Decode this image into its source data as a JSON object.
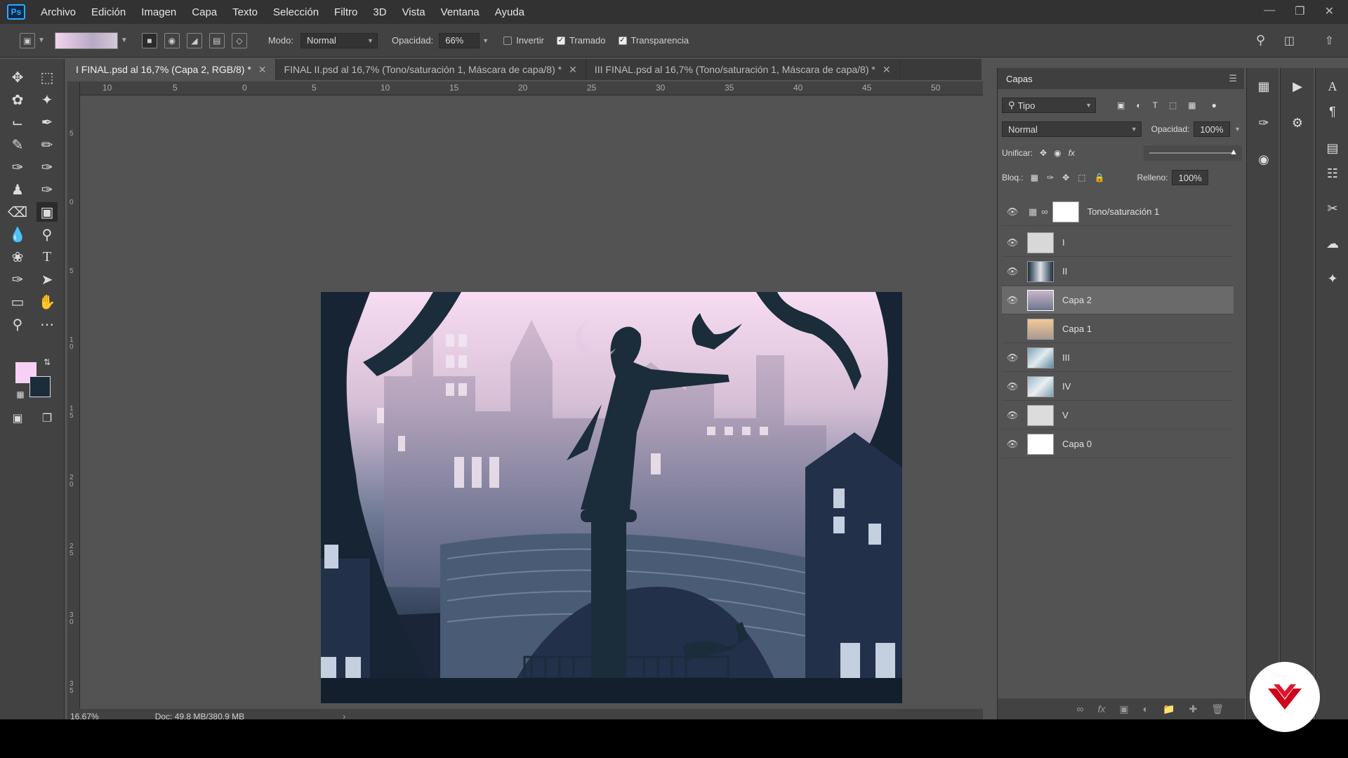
{
  "app": {
    "logo": "Ps",
    "menu": [
      "Archivo",
      "Edición",
      "Imagen",
      "Capa",
      "Texto",
      "Selección",
      "Filtro",
      "3D",
      "Vista",
      "Ventana",
      "Ayuda"
    ]
  },
  "options": {
    "mode_label": "Modo:",
    "mode_value": "Normal",
    "opacity_label": "Opacidad:",
    "opacity_value": "66%",
    "invert_label": "Invertir",
    "dither_label": "Tramado",
    "transparency_label": "Transparencia",
    "invert_checked": false,
    "dither_checked": true,
    "transparency_checked": true
  },
  "tabs": [
    {
      "label": "I FINAL.psd al 16,7% (Capa 2, RGB/8) *",
      "active": true
    },
    {
      "label": "FINAL II.psd al 16,7% (Tono/saturación 1, Máscara de capa/8) *",
      "active": false
    },
    {
      "label": "III FINAL.psd al 16,7% (Tono/saturación 1, Máscara de capa/8) *",
      "active": false
    }
  ],
  "ruler_top": [
    "10",
    "5",
    "0",
    "5",
    "10",
    "15",
    "20",
    "25",
    "30",
    "35",
    "40",
    "45",
    "50"
  ],
  "ruler_left": [
    "5",
    "0",
    "5",
    "1 0",
    "1 5",
    "2 0",
    "2 5",
    "3 0",
    "3 5"
  ],
  "status": {
    "zoom": "16,67%",
    "doc": "Doc: 49,8 MB/380,9 MB"
  },
  "layers_panel": {
    "title": "Capas",
    "filter_label": "Tipo",
    "blend_mode": "Normal",
    "opacity_label": "Opacidad:",
    "opacity_value": "100%",
    "unify_label": "Unificar:",
    "lock_label": "Bloq.:",
    "fill_label": "Relleno:",
    "fill_value": "100%",
    "layers": [
      {
        "name": "Tono/saturación 1",
        "visible": true,
        "selected": false
      },
      {
        "name": "I",
        "visible": true,
        "selected": false
      },
      {
        "name": "II",
        "visible": true,
        "selected": false
      },
      {
        "name": "Capa 2",
        "visible": true,
        "selected": true
      },
      {
        "name": "Capa 1",
        "visible": false,
        "selected": false
      },
      {
        "name": "III",
        "visible": true,
        "selected": false
      },
      {
        "name": "IV",
        "visible": true,
        "selected": false
      },
      {
        "name": "V",
        "visible": true,
        "selected": false
      },
      {
        "name": "Capa 0",
        "visible": true,
        "selected": false
      }
    ]
  },
  "colors": {
    "foreground": "#f9d0f5",
    "background": "#1b2c3b",
    "accent": "#31a8ff",
    "watermark": "#d0021b"
  }
}
